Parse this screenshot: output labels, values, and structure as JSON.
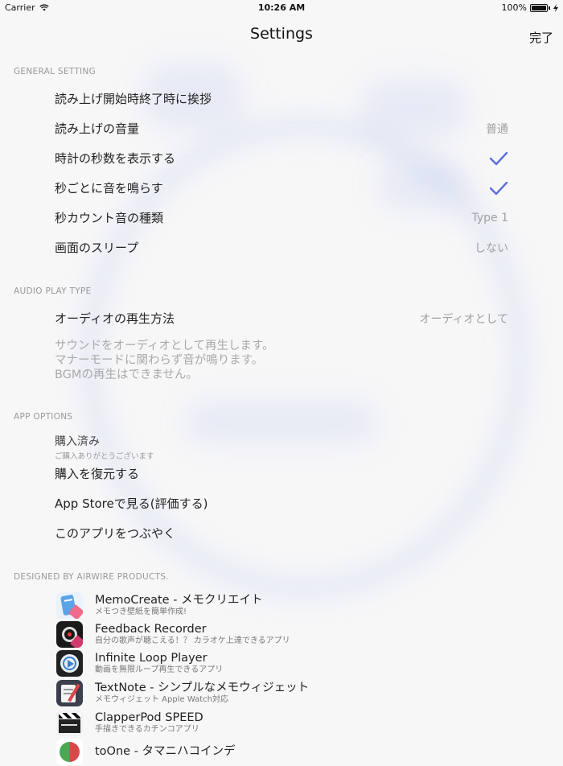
{
  "status": {
    "carrier": "Carrier",
    "time": "10:26 AM",
    "battery": "100%"
  },
  "nav": {
    "title": "Settings",
    "done": "完了"
  },
  "general": {
    "header": "GENERAL SETTING",
    "rows": [
      {
        "label": "読み上げ開始時終了時に挨拶",
        "value": ""
      },
      {
        "label": "読み上げの音量",
        "value": "普通"
      },
      {
        "label": "時計の秒数を表示する",
        "value": ""
      },
      {
        "label": "秒ごとに音を鳴らす",
        "value": ""
      },
      {
        "label": "秒カウント音の種類",
        "value": "Type 1"
      },
      {
        "label": "画面のスリープ",
        "value": "しない"
      }
    ]
  },
  "audio": {
    "header": "AUDIO PLAY TYPE",
    "row": {
      "label": "オーディオの再生方法",
      "value": "オーディオとして"
    },
    "note": [
      "サウンドをオーディオとして再生します。",
      "マナーモードに関わらず音が鳴ります。",
      "BGMの再生はできません。"
    ]
  },
  "options": {
    "header": "APP OPTIONS",
    "purchased": {
      "title": "購入済み",
      "subtitle": "ご購入ありがとうございます"
    },
    "rows": [
      "購入を復元する",
      "App Storeで見る(評価する)",
      "このアプリをつぶやく"
    ]
  },
  "products": {
    "header": "DESIGNED BY AIRWIRE PRODUCTS.",
    "apps": [
      {
        "name": "MemoCreate - メモクリエイト",
        "desc": "メモつき壁紙を簡単作成!",
        "icon": "memocreate-icon",
        "color": "#5aa3e6"
      },
      {
        "name": "Feedback Recorder",
        "desc": "自分の歌声が聴こえる！？ カラオケ上達できるアプリ",
        "icon": "feedback-recorder-icon",
        "color": "#1a1a1a"
      },
      {
        "name": "Infinite Loop Player",
        "desc": "動画を無限ループ再生できるアプリ",
        "icon": "infinite-loop-icon",
        "color": "#e9eef3"
      },
      {
        "name": "TextNote - シンプルなメモウィジェット",
        "desc": "メモウィジェット Apple Watch対応",
        "icon": "textnote-icon",
        "color": "#3c3f4c"
      },
      {
        "name": "ClapperPod SPEED",
        "desc": "手描きできるカチンコアプリ",
        "icon": "clapper-icon",
        "color": "#222222"
      },
      {
        "name": "toOne - タマニハコインデ",
        "desc": "",
        "icon": "toone-icon",
        "color": "#d94848"
      }
    ]
  },
  "accent": "#5b6fd6"
}
